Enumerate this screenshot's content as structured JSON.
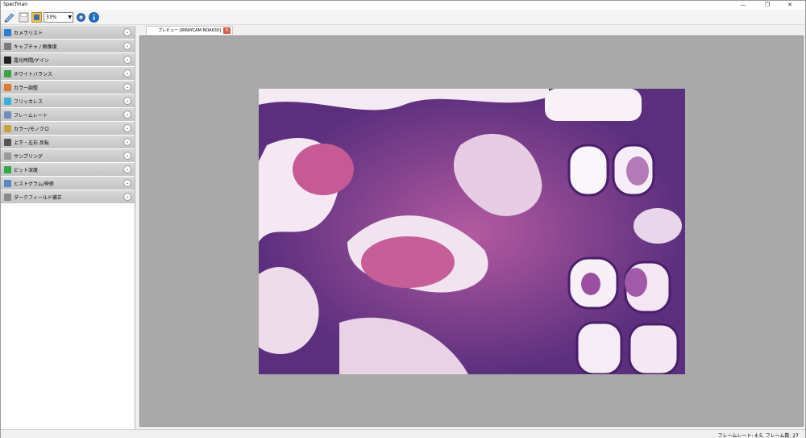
{
  "app": {
    "title": "Specfman"
  },
  "window_controls": {
    "minimize": "—",
    "restore": "❐",
    "close": "✕"
  },
  "toolbar": {
    "zoom": "33%",
    "icons": [
      "draw-icon",
      "save-icon",
      "capture-icon",
      "settings-gear-icon",
      "info-icon"
    ]
  },
  "sidebar": {
    "items": [
      {
        "label": "カメラリスト",
        "icon_color": "#2e7fd0"
      },
      {
        "label": "キャプチャ / 解像度",
        "icon_color": "#7a7a7a"
      },
      {
        "label": "露光時間/ゲイン",
        "icon_color": "#222222"
      },
      {
        "label": "ホワイトバランス",
        "icon_color": "#3aa24a"
      },
      {
        "label": "カラー調整",
        "icon_color": "#e07a2a"
      },
      {
        "label": "フリッカレス",
        "icon_color": "#3bb0d8"
      },
      {
        "label": "フレームレート",
        "icon_color": "#6f8fbf"
      },
      {
        "label": "カラー/モノクロ",
        "icon_color": "#c9a23a"
      },
      {
        "label": "上下・左右 反転",
        "icon_color": "#555555"
      },
      {
        "label": "サンプリング",
        "icon_color": "#9a9a9a"
      },
      {
        "label": "ビット深度",
        "icon_color": "#2ea84a"
      },
      {
        "label": "ヒストグラム/伸張",
        "icon_color": "#5a86c8"
      },
      {
        "label": "ダークフィールド補正",
        "icon_color": "#8a8a8a"
      }
    ]
  },
  "tabs": [
    {
      "label": "プレビュー [WRAYCAM-NOA630]"
    }
  ],
  "status": {
    "text": "フレームレート: 4.5, フレーム数: 27"
  },
  "colors": {
    "accent": "#2e7fd0",
    "tab_close": "#e05a4f",
    "preview_bg": "#a9a9a9"
  }
}
